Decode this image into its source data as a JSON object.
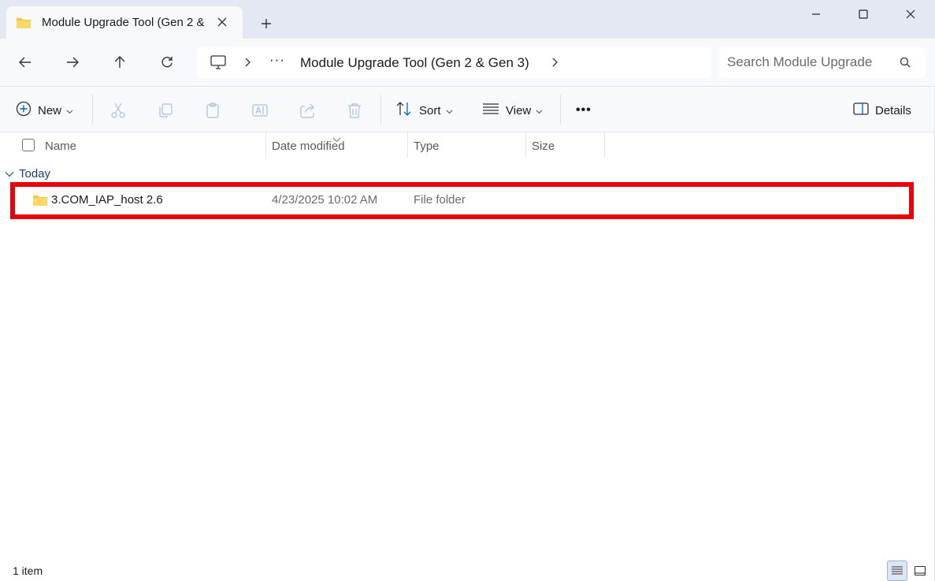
{
  "window": {
    "tab_title": "Module Upgrade Tool (Gen 2 & Gen 3)",
    "icons": {
      "tab_folder": "folder-icon",
      "close": "close-icon",
      "new_tab": "plus-icon",
      "minimize": "minimize-icon",
      "maximize": "maximize-icon",
      "close_window": "close-icon"
    }
  },
  "nav": {
    "back": "arrow-left-icon",
    "forward": "arrow-right-icon",
    "up": "arrow-up-icon",
    "refresh": "refresh-icon",
    "breadcrumb": {
      "root_icon": "this-pc-icon",
      "overflow": "···",
      "current": "Module Upgrade Tool (Gen 2 & Gen 3)"
    },
    "search_placeholder": "Search Module Upgrade"
  },
  "toolbar": {
    "new_label": "New",
    "sort_label": "Sort",
    "view_label": "View",
    "more_label": "•••",
    "details_label": "Details",
    "disabled_icons": [
      "cut-icon",
      "copy-icon",
      "paste-icon",
      "rename-icon",
      "share-icon",
      "delete-icon"
    ]
  },
  "columns": {
    "name": "Name",
    "date_modified": "Date modified",
    "type": "Type",
    "size": "Size"
  },
  "groups": [
    {
      "label": "Today",
      "items": [
        {
          "name": "3.COM_IAP_host 2.6",
          "date_modified": "4/23/2025 10:02 AM",
          "type": "File folder",
          "size": ""
        }
      ]
    }
  ],
  "status": {
    "item_count": "1 item"
  },
  "colors": {
    "highlight_border": "#e8000b",
    "group_text": "#1f3b7a",
    "folder": "#f4c542",
    "accent": "#0067c0"
  }
}
